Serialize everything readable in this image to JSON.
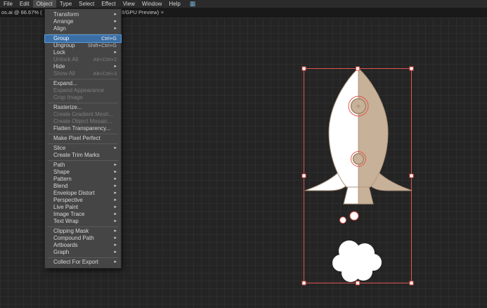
{
  "colors": {
    "app_bg": "#1f1f1f",
    "menubar_bg": "#2b2b2b",
    "menubar_text": "#d6d6d6",
    "tabbar_bg": "#191919",
    "tab_text": "#c6c6c6",
    "canvas_bg": "#242424",
    "grid_line": "#2d2d2d",
    "dropdown_bg": "#454545",
    "dropdown_border": "#262626",
    "menu_text": "#d8d8d8",
    "menu_disabled": "#7d7d7d",
    "highlight_bg": "#3a6ea5",
    "highlight_border": "#5b9bd5",
    "selection_red": "#e0564f",
    "rocket_tan": "#c8b199",
    "rocket_outline": "#b2977c",
    "window_ring": "#a08566",
    "white": "#ffffff"
  },
  "menu_bar": {
    "items": [
      "File",
      "Edit",
      "Object",
      "Type",
      "Select",
      "Effect",
      "View",
      "Window",
      "Help"
    ],
    "active": "Object",
    "workspace_icon": "▦"
  },
  "tab_bar": {
    "left_fragment": "os.ai @ 66.67% (",
    "tab_fragment": "s (RGB/GPU Preview)",
    "close_label": "×"
  },
  "object_menu": {
    "items": [
      {
        "label": "Transform",
        "submenu": true
      },
      {
        "label": "Arrange",
        "submenu": true
      },
      {
        "label": "Align",
        "submenu": true,
        "separator_after": true
      },
      {
        "label": "Group",
        "shortcut": "Ctrl+G",
        "highlighted": true
      },
      {
        "label": "Ungroup",
        "shortcut": "Shift+Ctrl+G"
      },
      {
        "label": "Lock",
        "submenu": true
      },
      {
        "label": "Unlock All",
        "shortcut": "Alt+Ctrl+2",
        "disabled": true
      },
      {
        "label": "Hide",
        "submenu": true
      },
      {
        "label": "Show All",
        "shortcut": "Alt+Ctrl+3",
        "disabled": true,
        "separator_after": true
      },
      {
        "label": "Expand..."
      },
      {
        "label": "Expand Appearance",
        "disabled": true
      },
      {
        "label": "Crop Image",
        "disabled": true,
        "separator_after": true
      },
      {
        "label": "Rasterize..."
      },
      {
        "label": "Create Gradient Mesh...",
        "disabled": true
      },
      {
        "label": "Create Object Mosaic...",
        "disabled": true
      },
      {
        "label": "Flatten Transparency...",
        "separator_after": true
      },
      {
        "label": "Make Pixel Perfect",
        "separator_after": true
      },
      {
        "label": "Slice",
        "submenu": true
      },
      {
        "label": "Create Trim Marks",
        "separator_after": true
      },
      {
        "label": "Path",
        "submenu": true
      },
      {
        "label": "Shape",
        "submenu": true
      },
      {
        "label": "Pattern",
        "submenu": true
      },
      {
        "label": "Blend",
        "submenu": true
      },
      {
        "label": "Envelope Distort",
        "submenu": true
      },
      {
        "label": "Perspective",
        "submenu": true
      },
      {
        "label": "Live Paint",
        "submenu": true
      },
      {
        "label": "Image Trace",
        "submenu": true
      },
      {
        "label": "Text Wrap",
        "submenu": true,
        "separator_after": true
      },
      {
        "label": "Clipping Mask",
        "submenu": true
      },
      {
        "label": "Compound Path",
        "submenu": true
      },
      {
        "label": "Artboards",
        "submenu": true
      },
      {
        "label": "Graph",
        "submenu": true,
        "separator_after": true
      },
      {
        "label": "Collect For Export",
        "submenu": true
      }
    ]
  }
}
